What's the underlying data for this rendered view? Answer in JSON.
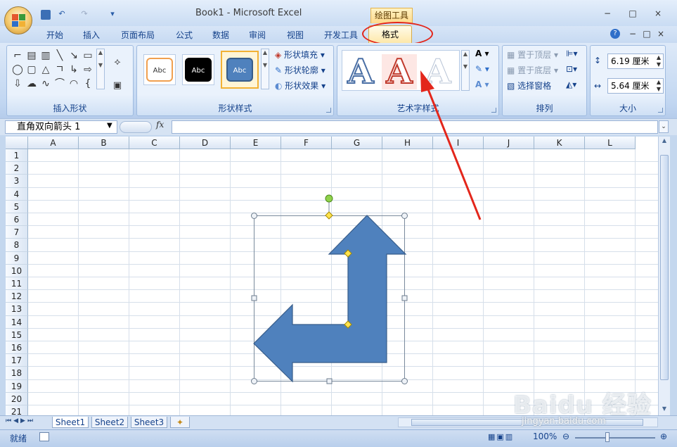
{
  "window": {
    "title": "Book1 - Microsoft Excel",
    "context_tab_title": "绘图工具",
    "min_label": "−",
    "max_label": "□",
    "close_label": "×"
  },
  "qat": {
    "undo": "↶",
    "redo": "↷",
    "customize": "▾"
  },
  "tabs": [
    "开始",
    "插入",
    "页面布局",
    "公式",
    "数据",
    "审阅",
    "视图",
    "开发工具",
    "格式"
  ],
  "help_icon": "?",
  "ribbon": {
    "groups": {
      "insert_shapes": "插入形状",
      "shape_styles": "形状样式",
      "wordart_styles": "艺术字样式",
      "arrange": "排列",
      "size": "大小"
    },
    "style_presets": [
      {
        "label": "Abc",
        "bg": "#ffffff",
        "border": "#f0a050",
        "color": "#333333"
      },
      {
        "label": "Abc",
        "bg": "#000000",
        "border": "#000000",
        "color": "#ffffff"
      },
      {
        "label": "Abc",
        "bg": "#4f81bd",
        "border": "#385d8a",
        "color": "#ffffff"
      }
    ],
    "shape_fill": "形状填充",
    "shape_outline": "形状轮廓",
    "shape_effects": "形状效果",
    "bring_front": "置于顶层",
    "send_back": "置于底层",
    "selection_pane": "选择窗格",
    "height_value": "6.19 厘米",
    "width_value": "5.64 厘米"
  },
  "formula_bar": {
    "name_box": "直角双向箭头 1",
    "fx": "fx"
  },
  "columns": [
    "A",
    "B",
    "C",
    "D",
    "E",
    "F",
    "G",
    "H",
    "I",
    "J",
    "K",
    "L"
  ],
  "rows": [
    "1",
    "2",
    "3",
    "4",
    "5",
    "6",
    "7",
    "8",
    "9",
    "10",
    "11",
    "12",
    "13",
    "14",
    "15",
    "16",
    "17",
    "18",
    "19",
    "20",
    "21"
  ],
  "sheets": [
    "Sheet1",
    "Sheet2",
    "Sheet3"
  ],
  "status": {
    "ready": "就绪",
    "zoom": "100%"
  },
  "watermark": {
    "main": "Baidu 经验",
    "sub": "jingyan.baidu.com"
  },
  "colors": {
    "shape_fill": "#4f81bd",
    "shape_stroke": "#385d8a",
    "annotation": "#e3261b"
  }
}
